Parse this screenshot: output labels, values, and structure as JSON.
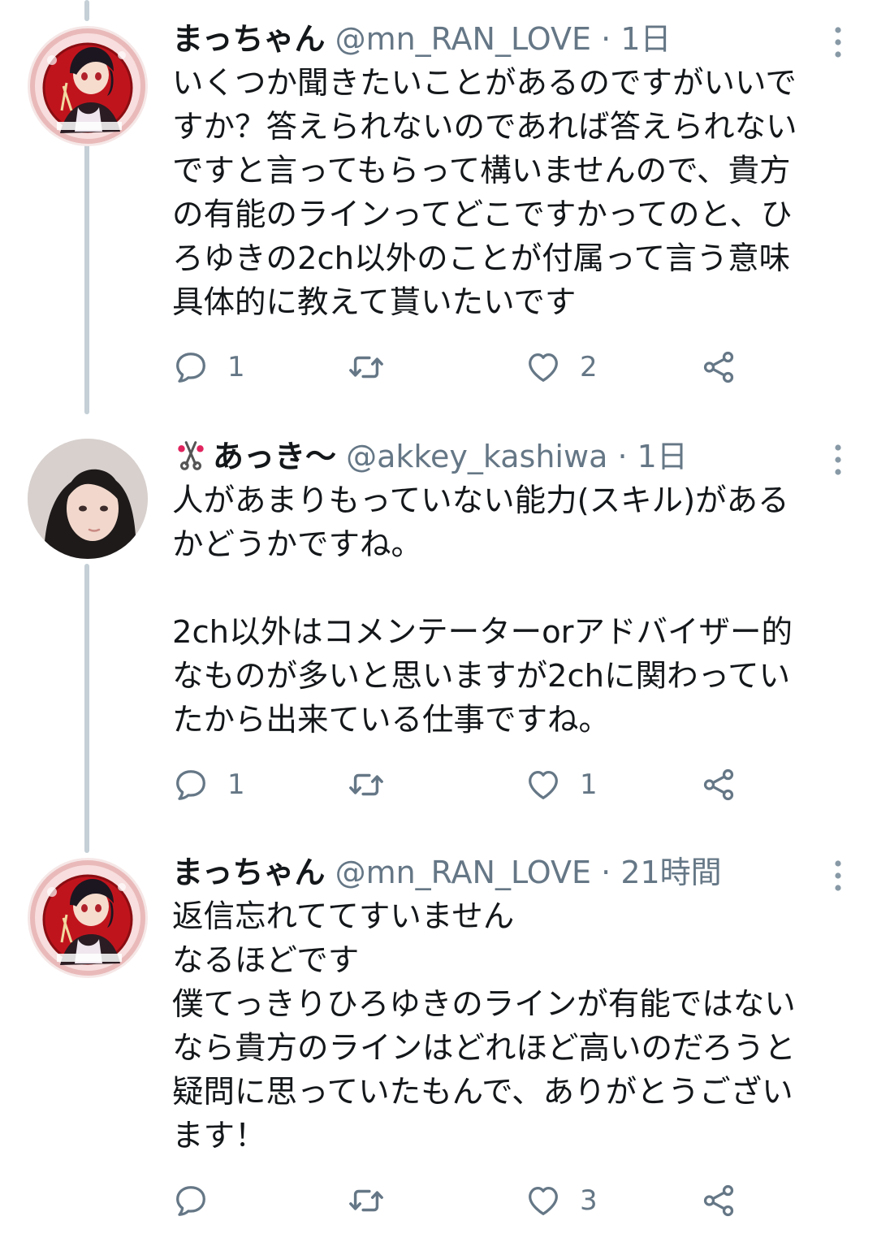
{
  "colors": {
    "text": "#14171a",
    "secondary": "#657786",
    "thread_line": "#c4cfd6"
  },
  "tweets": [
    {
      "display_name": "まっちゃん",
      "handle": "@mn_RAN_LOVE",
      "separator": "·",
      "time": "1日",
      "text": "いくつか聞きたいことがあるのですがいいで\nすか？答えられないのであれば答えられない\nですと言ってもらって構いませんので、貴方\nの有能のラインってどこですかってのと、ひ\nろゆきの2ch以外のことが付属って言う意味\n具体的に教えて貰いたいです",
      "reply_count": "1",
      "retweet_count": "",
      "like_count": "2",
      "avatar_icon": "anime-girl-avatar-icon"
    },
    {
      "display_name": "あっき〜",
      "name_emoji": "scissors-icon",
      "handle": "@akkey_kashiwa",
      "separator": "·",
      "time": "1日",
      "text": "人があまりもっていない能力(スキル)がある\nかどうかですね。\n\n2ch以外はコメンテーターorアドバイザー的\nなものが多いと思いますが2chに関わってい\nたから出来ている仕事ですね。",
      "reply_count": "1",
      "retweet_count": "",
      "like_count": "1",
      "avatar_icon": "person-photo-avatar-icon"
    },
    {
      "display_name": "まっちゃん",
      "handle": "@mn_RAN_LOVE",
      "separator": "·",
      "time": "21時間",
      "text": "返信忘れててすいません\nなるほどです\n僕てっきりひろゆきのラインが有能ではない\nなら貴方のラインはどれほど高いのだろうと\n疑問に思っていたもんで、ありがとうござい\nます！",
      "reply_count": "",
      "retweet_count": "",
      "like_count": "3",
      "avatar_icon": "anime-girl-avatar-icon"
    }
  ]
}
